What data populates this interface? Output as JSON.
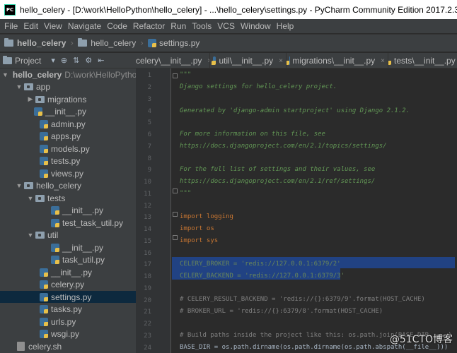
{
  "window": {
    "title": "hello_celery - [D:\\work\\HelloPython\\hello_celery] - ...\\hello_celery\\settings.py - PyCharm Community Edition 2017.2.3",
    "app_icon_text": "PC"
  },
  "menu": [
    "File",
    "Edit",
    "View",
    "Navigate",
    "Code",
    "Refactor",
    "Run",
    "Tools",
    "VCS",
    "Window",
    "Help"
  ],
  "breadcrumbs": [
    "hello_celery",
    "hello_celery",
    "settings.py"
  ],
  "project_panel": {
    "title": "Project",
    "tree": [
      {
        "label": "hello_celery",
        "path": "D:\\work\\HelloPytho",
        "kind": "root",
        "expanded": true
      },
      {
        "label": "app",
        "kind": "folder",
        "expanded": true
      },
      {
        "label": "migrations",
        "kind": "folder",
        "expanded": false
      },
      {
        "label": "__init__.py",
        "kind": "py"
      },
      {
        "label": "admin.py",
        "kind": "py"
      },
      {
        "label": "apps.py",
        "kind": "py"
      },
      {
        "label": "models.py",
        "kind": "py"
      },
      {
        "label": "tests.py",
        "kind": "py"
      },
      {
        "label": "views.py",
        "kind": "py"
      },
      {
        "label": "hello_celery",
        "kind": "folder",
        "expanded": true
      },
      {
        "label": "tests",
        "kind": "folder",
        "expanded": true
      },
      {
        "label": "__init__.py",
        "kind": "py"
      },
      {
        "label": "test_task_util.py",
        "kind": "py"
      },
      {
        "label": "util",
        "kind": "folder",
        "expanded": true
      },
      {
        "label": "__init__.py",
        "kind": "py"
      },
      {
        "label": "task_util.py",
        "kind": "py"
      },
      {
        "label": "__init__.py",
        "kind": "py"
      },
      {
        "label": "celery.py",
        "kind": "py"
      },
      {
        "label": "settings.py",
        "kind": "py",
        "selected": true
      },
      {
        "label": "tasks.py",
        "kind": "py"
      },
      {
        "label": "urls.py",
        "kind": "py"
      },
      {
        "label": "wsgi.py",
        "kind": "py"
      },
      {
        "label": "celery.sh",
        "kind": "sh"
      }
    ]
  },
  "tabs": [
    "celery\\__init__.py",
    "util\\__init__.py",
    "migrations\\__init__.py",
    "tests\\__init__.py"
  ],
  "editor": {
    "line_numbers": [
      "1",
      "2",
      "3",
      "4",
      "5",
      "6",
      "7",
      "8",
      "9",
      "10",
      "11",
      "12",
      "13",
      "14",
      "15",
      "16",
      "17",
      "18",
      "19",
      "20",
      "21",
      "22",
      "23",
      "24"
    ],
    "lines": [
      "\"\"\"",
      "Django settings for hello_celery project.",
      "",
      "Generated by 'django-admin startproject' using Django 2.1.2.",
      "",
      "For more information on this file, see",
      "https://docs.djangoproject.com/en/2.1/topics/settings/",
      "",
      "For the full list of settings and their values, see",
      "https://docs.djangoproject.com/en/2.1/ref/settings/",
      "\"\"\"",
      "",
      "import logging",
      "import os",
      "import sys",
      "",
      "CELERY_BROKER = 'redis://127.0.0.1:6379/2'",
      "CELERY_BACKEND = 'redis://127.0.0.1:6379/3'",
      "",
      "# CELERY_RESULT_BACKEND = 'redis://{}:6379/9'.format(HOST_CACHE)",
      "# BROKER_URL = 'redis://{}:6379/8'.format(HOST_CACHE)",
      "",
      "# Build paths inside the project like this: os.path.join(BASE_DIR, ...)",
      "BASE_DIR = os.path.dirname(os.path.dirname(os.path.abspath(__file__)))"
    ]
  },
  "watermark": "@51CTO博客"
}
